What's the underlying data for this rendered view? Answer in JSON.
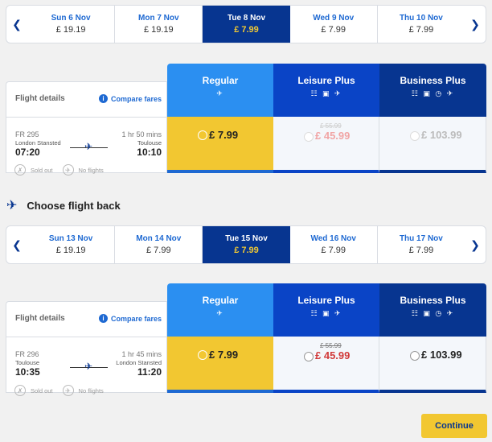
{
  "outbound": {
    "dates": [
      {
        "day": "Sun 6 Nov",
        "price": "£ 19.19",
        "selected": false
      },
      {
        "day": "Mon 7 Nov",
        "price": "£ 19.19",
        "selected": false
      },
      {
        "day": "Tue 8 Nov",
        "price": "£ 7.99",
        "selected": true
      },
      {
        "day": "Wed 9 Nov",
        "price": "£ 7.99",
        "selected": false
      },
      {
        "day": "Thu 10 Nov",
        "price": "£ 7.99",
        "selected": false
      }
    ],
    "flight_details_label": "Flight details",
    "compare_label": "Compare fares",
    "flight": {
      "number": "FR 295",
      "from": "London Stansted",
      "departure": "07:20",
      "duration": "1 hr 50 mins",
      "to": "Toulouse",
      "arrival": "10:10"
    },
    "fares": {
      "regular": {
        "name": "Regular",
        "price": "£ 7.99"
      },
      "leisure": {
        "name": "Leisure Plus",
        "old_price": "£ 55.99",
        "price": "£ 45.99"
      },
      "business": {
        "name": "Business Plus",
        "price": "£ 103.99"
      }
    },
    "legend": {
      "sold_out": "Sold out",
      "no_flights": "No flights"
    }
  },
  "return_title": "Choose flight back",
  "inbound": {
    "dates": [
      {
        "day": "Sun 13 Nov",
        "price": "£ 19.19",
        "selected": false
      },
      {
        "day": "Mon 14 Nov",
        "price": "£ 7.99",
        "selected": false
      },
      {
        "day": "Tue 15 Nov",
        "price": "£ 7.99",
        "selected": true
      },
      {
        "day": "Wed 16 Nov",
        "price": "£ 7.99",
        "selected": false
      },
      {
        "day": "Thu 17 Nov",
        "price": "£ 7.99",
        "selected": false
      }
    ],
    "flight_details_label": "Flight details",
    "compare_label": "Compare fares",
    "flight": {
      "number": "FR 296",
      "from": "Toulouse",
      "departure": "10:35",
      "duration": "1 hr 45 mins",
      "to": "London Stansted",
      "arrival": "11:20"
    },
    "fares": {
      "regular": {
        "name": "Regular",
        "price": "£ 7.99"
      },
      "leisure": {
        "name": "Leisure Plus",
        "old_price": "£ 55.99",
        "price": "£ 45.99"
      },
      "business": {
        "name": "Business Plus",
        "price": "£ 103.99"
      }
    },
    "legend": {
      "sold_out": "Sold out",
      "no_flights": "No flights"
    }
  },
  "continue_label": "Continue",
  "colors": {
    "navy": "#073590",
    "blue": "#1e69d2",
    "yellow": "#f2c731",
    "red": "#d13a3a"
  }
}
